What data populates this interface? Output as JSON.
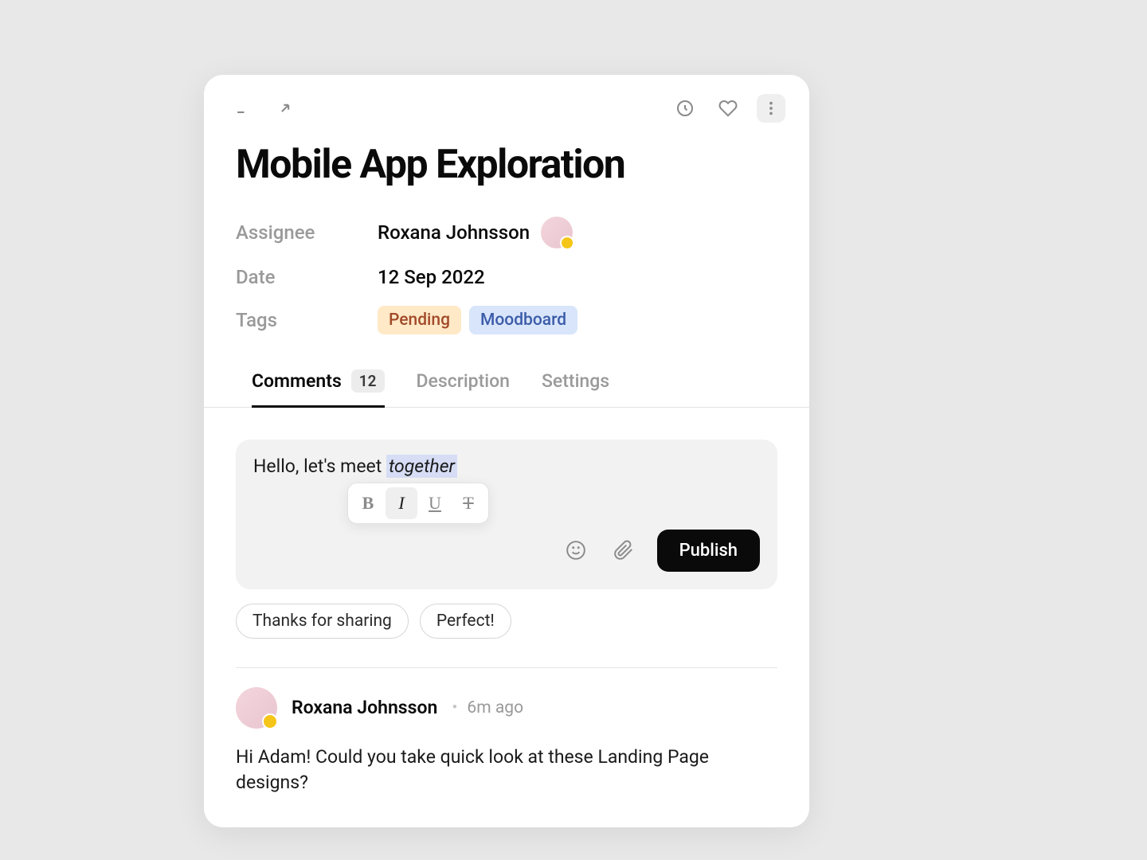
{
  "title": "Mobile App Exploration",
  "meta": {
    "assignee_label": "Assignee",
    "assignee_name": "Roxana Johnsson",
    "date_label": "Date",
    "date_value": "12 Sep 2022",
    "tags_label": "Tags"
  },
  "tags": [
    {
      "label": "Pending",
      "style": "pending"
    },
    {
      "label": "Moodboard",
      "style": "moodboard"
    }
  ],
  "tabs": {
    "comments": {
      "label": "Comments",
      "count": "12"
    },
    "description": {
      "label": "Description"
    },
    "settings": {
      "label": "Settings"
    }
  },
  "composer": {
    "text_prefix": "Hello, let's meet ",
    "text_selected": "together",
    "publish_label": "Publish",
    "format": {
      "bold": "B",
      "italic": "I",
      "underline": "U",
      "strike": "T"
    }
  },
  "suggestions": [
    "Thanks for sharing",
    "Perfect!"
  ],
  "comments": [
    {
      "author": "Roxana Johnsson",
      "time": "6m ago",
      "body": "Hi Adam! Could you take quick look at these Landing Page designs?"
    }
  ]
}
